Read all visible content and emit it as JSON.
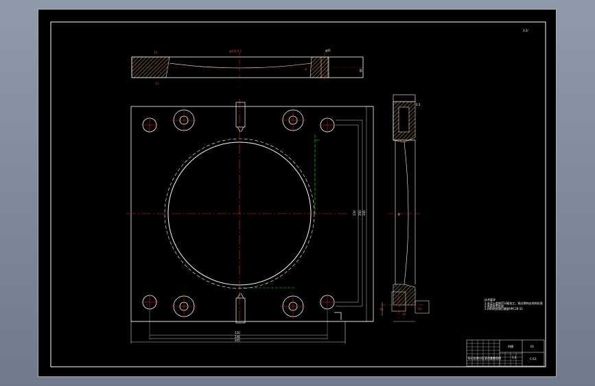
{
  "sheet": {
    "corner_mark": "3.2/"
  },
  "top_view": {
    "left_label_top": "13",
    "left_label_bottom": "13",
    "center_label": "φ250  0.2",
    "spot_label": "φ45",
    "right_dim": "36",
    "right_label": "φ"
  },
  "front_view": {
    "dims_bottom": [
      "230",
      "248",
      "345"
    ],
    "dims_right": [
      "230",
      "250",
      "345"
    ]
  },
  "side_view": {
    "top_label": "0.5",
    "mid_label": "R",
    "lower_dims": [
      "30",
      "16",
      "14"
    ]
  },
  "notes": {
    "title": "技术要求",
    "lines": [
      "1.未注公差按IT14级加工，锐边倒钝去毛刺处理",
      "2.表面发黑处理",
      "3.材料热处理后硬度HRC28-32"
    ]
  },
  "title_block": {
    "part_name": "凹模",
    "drawing_no": "01",
    "rows": [
      "标记",
      "处数",
      "分区",
      "更改文件号",
      "签名",
      "日期"
    ],
    "material": "Cr12",
    "scale": "1:2"
  },
  "colors": {
    "outline": "#ffffff",
    "center_line": "#ff2020",
    "hidden_line": "#00ff00",
    "hatch": "#c9a040"
  }
}
